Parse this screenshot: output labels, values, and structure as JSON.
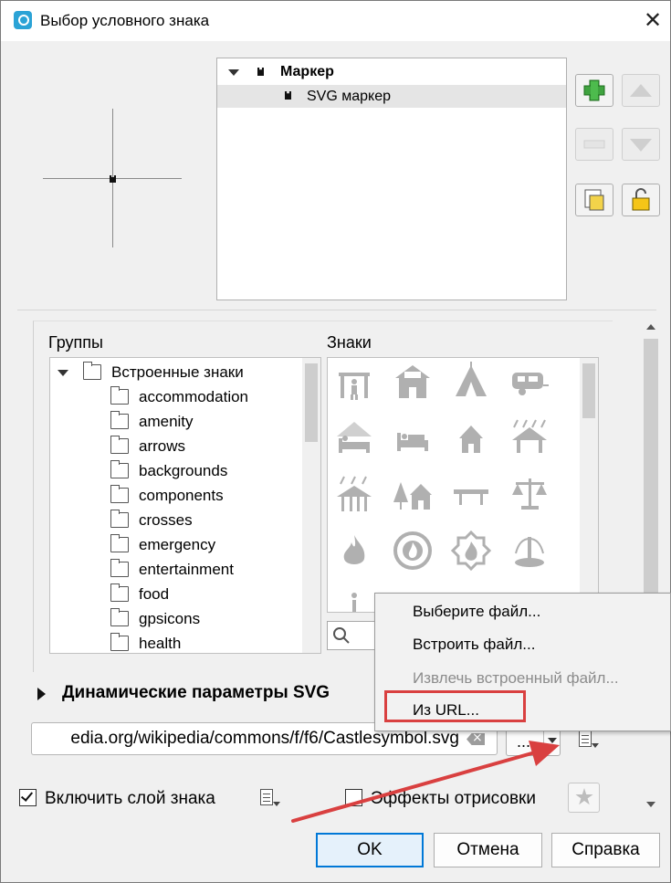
{
  "window": {
    "title": "Выбор условного знака",
    "close_label": "✕"
  },
  "layers": {
    "root_label": "Маркер",
    "child_label": "SVG маркер"
  },
  "library": {
    "groups_title": "Группы",
    "marks_title": "Знаки",
    "root_group": "Встроенные знаки",
    "groups": [
      "accommodation",
      "amenity",
      "arrows",
      "backgrounds",
      "components",
      "crosses",
      "emergency",
      "entertainment",
      "food",
      "gpsicons",
      "health"
    ]
  },
  "symbols": [
    "hiking-icon",
    "hotel-icon",
    "camping-tent-icon",
    "caravan-icon",
    "house-bed-icon",
    "bed-icon",
    "house-icon",
    "shelter-rain-icon",
    "rain-shelter-icon",
    "cabin-trees-icon",
    "bench-icon",
    "scales-icon",
    "fire-icon",
    "fire-station-icon",
    "fire-brigade-icon",
    "fountain-icon"
  ],
  "dynamic": {
    "label": "Динамические параметры SVG"
  },
  "svg_path": {
    "value": "edia.org/wikipedia/commons/f/f6/Castlesymbol.svg",
    "button_label": "..."
  },
  "context_menu": {
    "items": [
      "Выберите файл...",
      "Встроить файл...",
      "Извлечь встроенный файл...",
      "Из URL..."
    ],
    "highlighted": "Из URL...",
    "highlight_color": "#d94040"
  },
  "options": {
    "enable_layer_label": "Включить слой знака",
    "enable_layer_checked": true,
    "effects_label": "Эффекты отрисовки",
    "effects_checked": false
  },
  "footer": {
    "ok_label": "OK",
    "cancel_label": "Отмена",
    "help_label": "Справка"
  },
  "colors": {
    "accent": "#0078d7",
    "annotation_arrow": "#d94040",
    "symbol_gray": "#b0b0b0"
  }
}
